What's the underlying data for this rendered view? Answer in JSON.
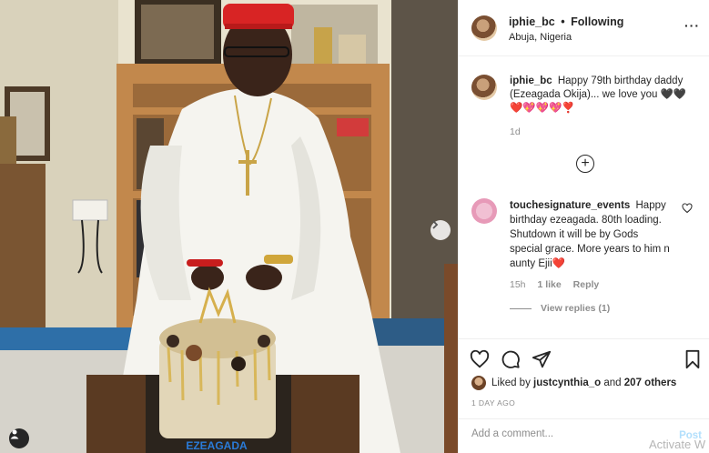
{
  "photo": {
    "cake_text": "EZEAGADA"
  },
  "post_header": {
    "username": "iphie_bc",
    "separator": "•",
    "follow_status": "Following",
    "location": "Abuja, Nigeria",
    "more_glyph": "···"
  },
  "caption": {
    "username": "iphie_bc",
    "text": "Happy 79th birthday daddy (Ezeagada Okija)... we love you 🖤🖤❤️💖💖💖❣️",
    "time": "1d"
  },
  "load_more_glyph": "+",
  "comment": {
    "username": "touchesignature_events",
    "text": "Happy birthday ezeagada. 80th loading. Shutdown it will be by Gods special grace. More years to him n aunty Ejii❤️",
    "time": "15h",
    "likes": "1 like",
    "reply_label": "Reply",
    "view_replies": "View replies (1)"
  },
  "likes": {
    "prefix": "Liked by",
    "user": "justcynthia_o",
    "middle": "and",
    "others": "207 others"
  },
  "date": "1 DAY AGO",
  "add_comment": {
    "placeholder": "Add a comment...",
    "post_label": "Post"
  },
  "watermark": "Activate W"
}
